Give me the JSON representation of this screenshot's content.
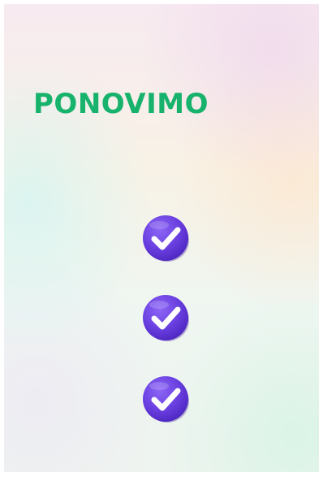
{
  "screen": {
    "title": "PONOVIMO"
  },
  "checks": [
    {
      "icon": "check-badge-icon"
    },
    {
      "icon": "check-badge-icon"
    },
    {
      "icon": "check-badge-icon"
    }
  ],
  "colors": {
    "title": "#17b26c",
    "badge": "#6a3fe0",
    "badge_shade": "#4f28c2",
    "check": "#ffffff"
  }
}
